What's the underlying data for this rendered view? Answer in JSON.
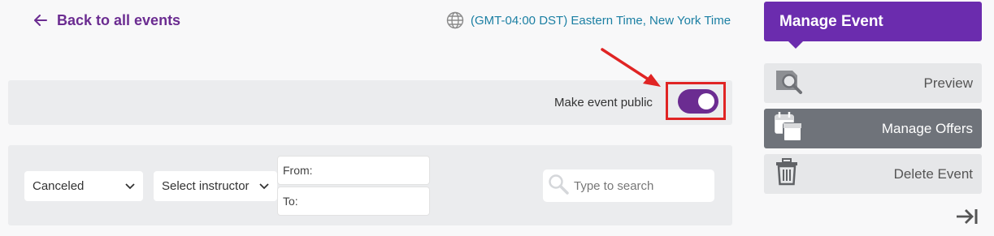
{
  "header": {
    "back_label": "Back to all events",
    "timezone": "(GMT-04:00 DST) Eastern Time, New York Time"
  },
  "publish": {
    "label": "Make event public",
    "toggle_on": true
  },
  "filters": {
    "status_value": "Canceled",
    "instructor_value": "Select instructor",
    "from_label": "From:",
    "to_label": "To:",
    "search_placeholder": "Type to search"
  },
  "sidebar": {
    "title": "Manage Event",
    "buttons": [
      {
        "label": "Preview",
        "icon": "preview-icon"
      },
      {
        "label": "Manage Offers",
        "icon": "calendar-stack-icon"
      },
      {
        "label": "Delete Event",
        "icon": "trash-icon"
      }
    ],
    "collapse_icon": "collapse-right-icon"
  },
  "colors": {
    "brand_purple": "#6b2cae",
    "toggle_purple": "#6b2c91",
    "link_teal": "#1b7fa3",
    "annotation_red": "#e02424",
    "panel_gray": "#ebecee",
    "active_button": "#6f737a"
  }
}
